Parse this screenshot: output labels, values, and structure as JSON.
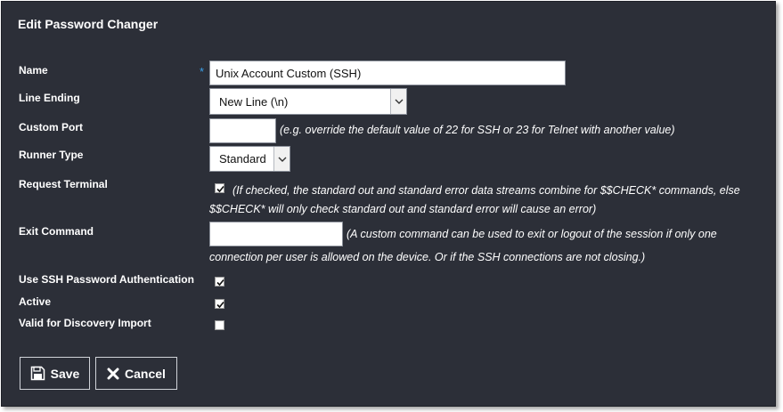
{
  "dialog": {
    "title": "Edit Password Changer"
  },
  "fields": {
    "name": {
      "label": "Name",
      "required_marker": "*",
      "value": "Unix Account Custom (SSH)"
    },
    "line_ending": {
      "label": "Line Ending",
      "selected": "New Line (\\n)"
    },
    "custom_port": {
      "label": "Custom Port",
      "value": "",
      "hint": "(e.g. override the default value of 22 for SSH or 23 for Telnet with another value)"
    },
    "runner_type": {
      "label": "Runner Type",
      "selected": "Standard"
    },
    "request_terminal": {
      "label": "Request Terminal",
      "checked": true,
      "hint_line1": "(If checked, the standard out and standard error data streams combine for $$CHECK* commands, else",
      "hint_line2": "$$CHECK* will only check standard out and standard error will cause an error)"
    },
    "exit_command": {
      "label": "Exit Command",
      "value": "",
      "hint_line1": "(A custom command can be used to exit or logout of the session if only one",
      "hint_line2": "connection per user is allowed on the device. Or if the SSH connections are not closing.)"
    },
    "use_ssh_password_auth": {
      "label": "Use SSH Password Authentication",
      "checked": true
    },
    "active": {
      "label": "Active",
      "checked": true
    },
    "valid_for_discovery": {
      "label": "Valid for Discovery Import",
      "checked": false
    }
  },
  "buttons": {
    "save_label": "Save",
    "cancel_label": "Cancel"
  },
  "icons": {
    "save": "floppy-disk-icon",
    "cancel": "x-icon",
    "dropdown": "chevron-down-icon",
    "check": "check-icon"
  }
}
